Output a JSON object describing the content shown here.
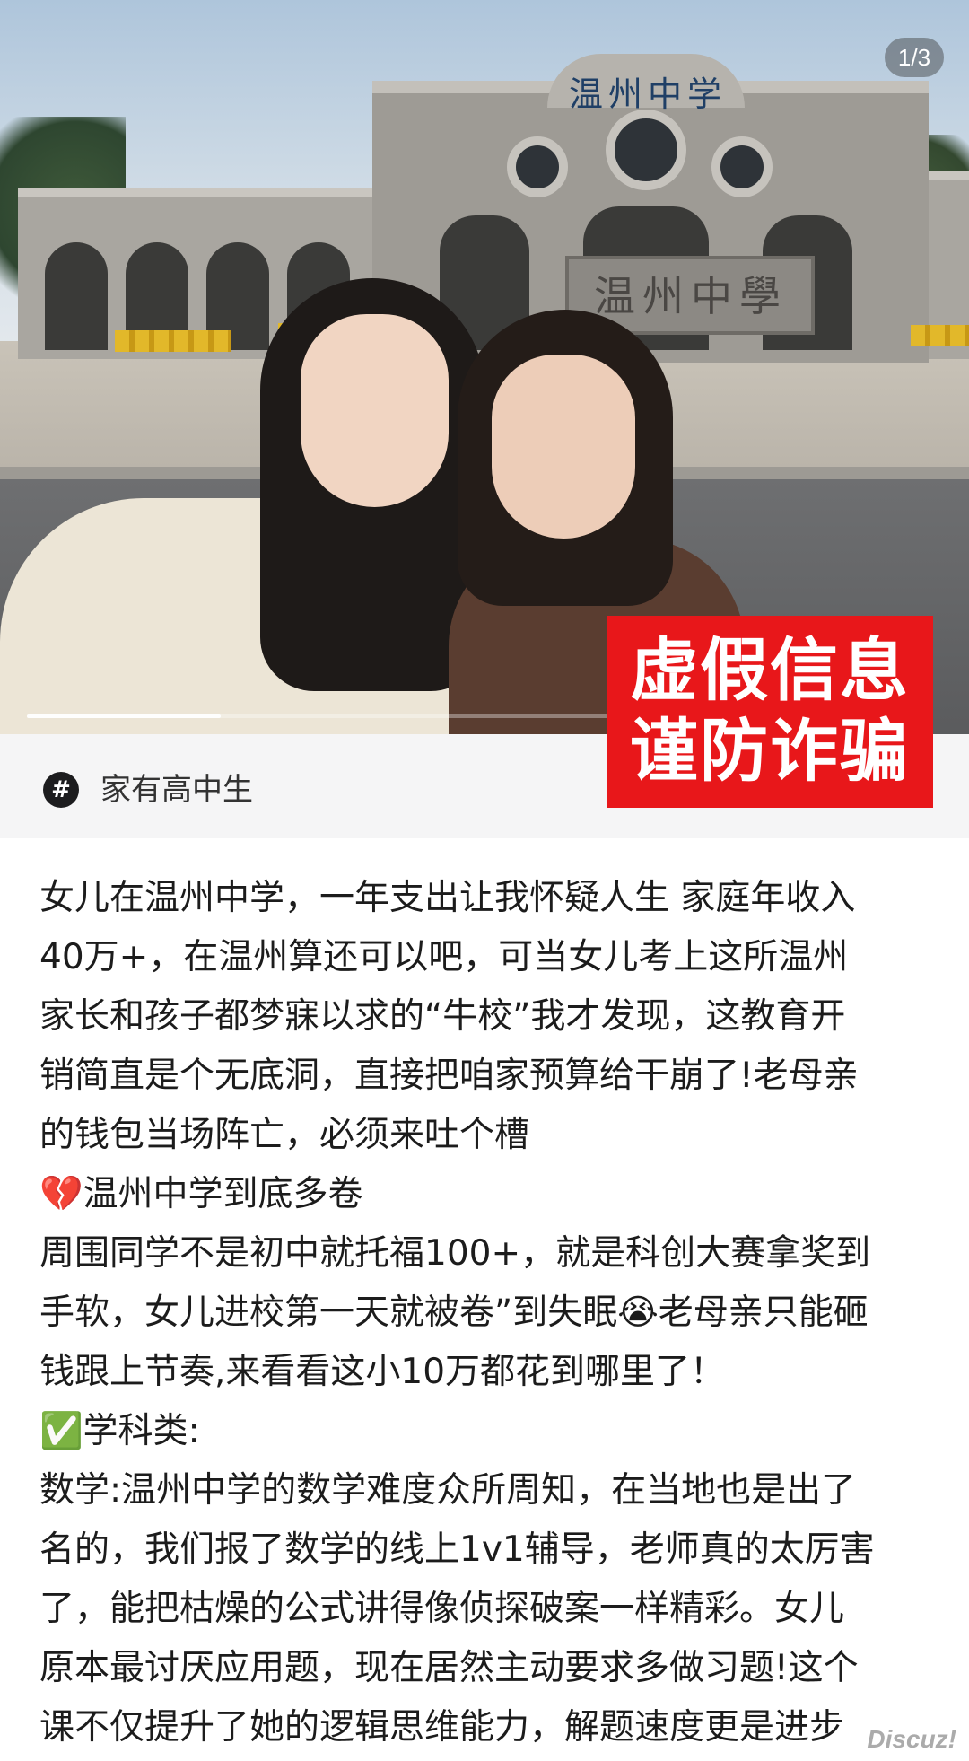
{
  "carousel": {
    "page_indicator": "1/3",
    "current_page": 1,
    "total_pages": 3,
    "progress": 0.333,
    "sign_top": "温州中学",
    "sign_plaque": "温州中學"
  },
  "warning_overlay": {
    "line1": "虚假信息",
    "line2": "谨防诈骗",
    "color": "#e8171a"
  },
  "topic": {
    "icon": "hashtag-icon",
    "label": "家有高中生"
  },
  "article": {
    "lines": [
      "女儿在温州中学，一年支出让我怀疑人生 家庭年收入",
      "40万+，在温州算还可以吧，可当女儿考上这所温州",
      "家长和孩子都梦寐以求的“牛校”我才发现，这教育开",
      "销简直是个无底洞，直接把咱家预算给干崩了!老母亲",
      "的钱包当场阵亡，必须来吐个槽",
      "💔温州中学到底多卷",
      "周围同学不是初中就托福100+，就是科创大赛拿奖到",
      "手软，女儿进校第一天就被卷”到失眠😭老母亲只能砸",
      "钱跟上节奏,来看看这小10万都花到哪里了！",
      "✅学科类:",
      "数学:温州中学的数学难度众所周知，在当地也是出了",
      "名的，我们报了数学的线上1v1辅导，老师真的太厉害",
      "了，能把枯燥的公式讲得像侦探破案一样精彩。女儿",
      "原本最讨厌应用题，现在居然主动要求多做习题!这个",
      "课不仅提升了她的逻辑思维能力，解题速度更是进步"
    ]
  },
  "watermark": "Discuz!"
}
